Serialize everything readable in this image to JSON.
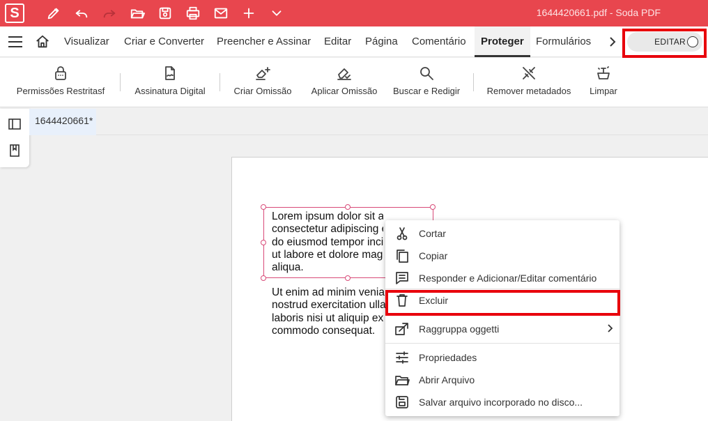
{
  "app": {
    "logo_letter": "S",
    "title": "1644420661.pdf  -  Soda PDF",
    "brand_color": "#e8464e"
  },
  "quick_toolbar": [
    "pen-icon",
    "undo-icon",
    "redo-icon",
    "open-folder-icon",
    "save-icon",
    "print-icon",
    "mail-icon",
    "plus-icon",
    "chevron-down-icon"
  ],
  "menu": {
    "tabs": [
      "Visualizar",
      "Criar e Converter",
      "Preencher e Assinar",
      "Editar",
      "Página",
      "Comentário",
      "Proteger",
      "Formulários"
    ],
    "active_tab": "Proteger",
    "edit_toggle_label": "EDITAR"
  },
  "ribbon": {
    "items": [
      {
        "label": "Permissões Restritasf",
        "icon": "lock-icon"
      },
      {
        "label": "Assinatura Digital",
        "icon": "signature-icon"
      },
      {
        "label": "Criar Omissão",
        "icon": "eraser-plus-icon"
      },
      {
        "label": "Aplicar Omissão",
        "icon": "eraser-check-icon"
      },
      {
        "label": "Buscar e Redigir",
        "icon": "search-icon"
      },
      {
        "label": "Remover metadados",
        "icon": "tag-remove-icon"
      },
      {
        "label": "Limpar",
        "icon": "clean-icon"
      }
    ]
  },
  "document": {
    "tab_label": "1644420661*",
    "paragraph1": [
      "Lorem ipsum dolor sit amet,",
      "consectetur adipiscing elit, sed",
      "do eiusmod tempor incididunt",
      "ut labore et dolore magna",
      "aliqua."
    ],
    "paragraph2": [
      "Ut enim ad minim veniam, quis",
      "nostrud exercitation ullamco",
      "laboris nisi ut aliquip ex ea",
      "commodo consequat."
    ]
  },
  "context_menu": {
    "items": [
      {
        "label": "Cortar",
        "icon": "scissors-icon"
      },
      {
        "label": "Copiar",
        "icon": "copy-icon"
      },
      {
        "label": "Responder e Adicionar/Editar comentário",
        "icon": "comment-icon"
      },
      {
        "label": "Excluir",
        "icon": "trash-icon"
      },
      {
        "label": "Raggruppa oggetti",
        "icon": "group-objects-icon"
      },
      {
        "label": "Propriedades",
        "icon": "sliders-icon"
      },
      {
        "label": "Abrir Arquivo",
        "icon": "folder-open-icon"
      },
      {
        "label": "Salvar arquivo incorporado no disco...",
        "icon": "save-icon"
      }
    ]
  },
  "highlight_color": "#e8000b"
}
